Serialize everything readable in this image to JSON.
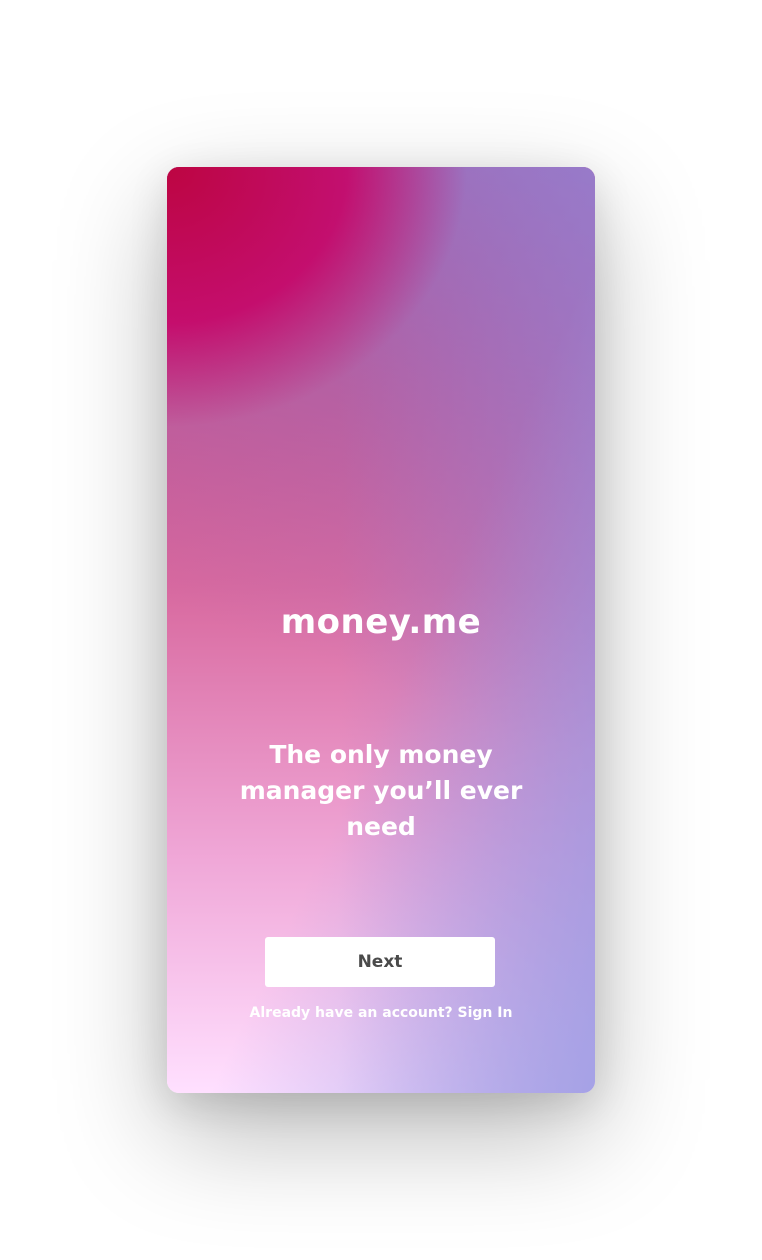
{
  "app": {
    "brand": "money.me",
    "tagline": "The only money manager you’ll ever need"
  },
  "actions": {
    "next_label": "Next",
    "account_prompt": "Already have an account?",
    "signin_label": "Sign In"
  },
  "colors": {
    "page_background": "#ffffff",
    "gradient_top_left": "#c0003c",
    "gradient_bottom_left": "#ffe0ff",
    "gradient_bottom_right": "#a8a8e6",
    "button_background": "#ffffff",
    "button_text": "#4a4a4a",
    "text": "#ffffff"
  }
}
